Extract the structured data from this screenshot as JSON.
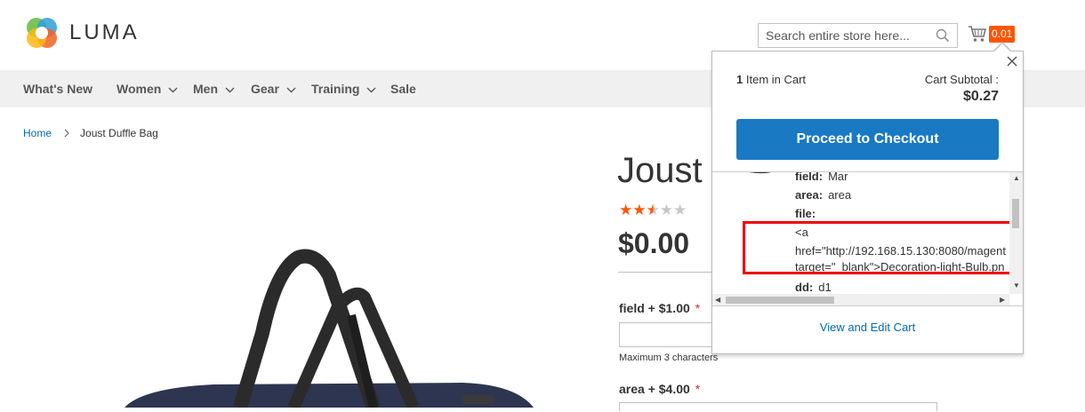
{
  "header": {
    "logo_text": "LUMA",
    "search_placeholder": "Search entire store here...",
    "cart_count": "0.01"
  },
  "nav": {
    "items": [
      {
        "label": "What's New",
        "has_dropdown": false
      },
      {
        "label": "Women",
        "has_dropdown": true
      },
      {
        "label": "Men",
        "has_dropdown": true
      },
      {
        "label": "Gear",
        "has_dropdown": true
      },
      {
        "label": "Training",
        "has_dropdown": true
      },
      {
        "label": "Sale",
        "has_dropdown": false
      }
    ]
  },
  "breadcrumb": {
    "home": "Home",
    "current": "Joust Duffle Bag"
  },
  "product": {
    "title": "Joust D",
    "rating": 2.5,
    "rating_max": 5,
    "price": "$0.00",
    "options": [
      {
        "label": "field + $1.00",
        "required": "*",
        "note": "Maximum 3 characters"
      },
      {
        "label": "area + $4.00",
        "required": "*"
      }
    ]
  },
  "minicart": {
    "count": "1",
    "count_label": "Item in Cart",
    "subtotal_label": "Cart Subtotal :",
    "subtotal_value": "$0.27",
    "checkout_label": "Proceed to Checkout",
    "item_options": [
      {
        "key": "field:",
        "value": "Mar"
      },
      {
        "key": "area:",
        "value": "area"
      },
      {
        "key": "file:",
        "value": ""
      }
    ],
    "file_value_lines": [
      "<a",
      "href=\"http://192.168.15.130:8080/magent",
      "target=\"_blank\">Decoration-light-Bulb.pn"
    ],
    "last_option": {
      "key": "dd:",
      "value": "d1"
    },
    "view_cart_label": "View and Edit Cart"
  },
  "colors": {
    "accent_orange": "#ff5501",
    "primary_blue": "#1979c3",
    "link_blue": "#006bb4",
    "star_filled": "#ff5501",
    "highlight_red": "#e00000"
  }
}
